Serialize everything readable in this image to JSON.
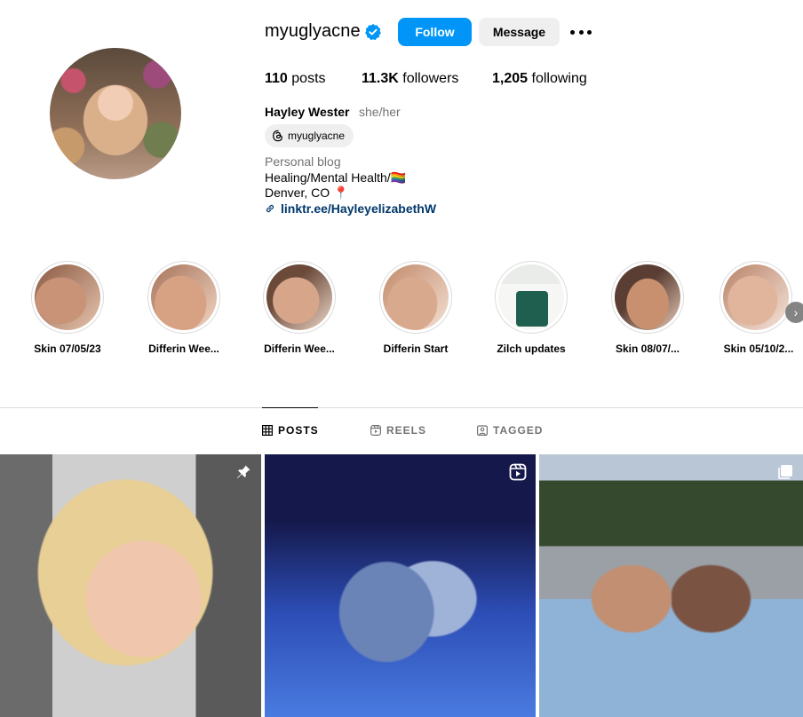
{
  "profile": {
    "username": "myuglyacne",
    "follow_label": "Follow",
    "message_label": "Message",
    "stats": {
      "posts_count": "110",
      "posts_label": "posts",
      "followers_count": "11.3K",
      "followers_label": "followers",
      "following_count": "1,205",
      "following_label": "following"
    },
    "full_name": "Hayley Wester",
    "pronouns": "she/her",
    "threads_handle": "myuglyacne",
    "category": "Personal blog",
    "bio_line1": "Healing/Mental Health/🏳️‍🌈",
    "bio_line2": "Denver, CO 📍",
    "link": "linktr.ee/HayleyelizabethW"
  },
  "highlights": [
    {
      "label": "Skin 07/05/23"
    },
    {
      "label": "Differin Wee..."
    },
    {
      "label": "Differin Wee..."
    },
    {
      "label": "Differin Start"
    },
    {
      "label": "Zilch updates"
    },
    {
      "label": "Skin 08/07/..."
    },
    {
      "label": "Skin 05/10/2..."
    }
  ],
  "tabs": [
    {
      "label": "POSTS",
      "active": true
    },
    {
      "label": "REELS",
      "active": false
    },
    {
      "label": "TAGGED",
      "active": false
    }
  ],
  "posts": [
    {
      "badge": "pin-icon"
    },
    {
      "badge": "reel-icon"
    },
    {
      "badge": "carousel-icon"
    }
  ],
  "colors": {
    "accent": "#0095f6",
    "link": "#00376b",
    "muted": "#737373",
    "border": "#dbdbdb"
  }
}
